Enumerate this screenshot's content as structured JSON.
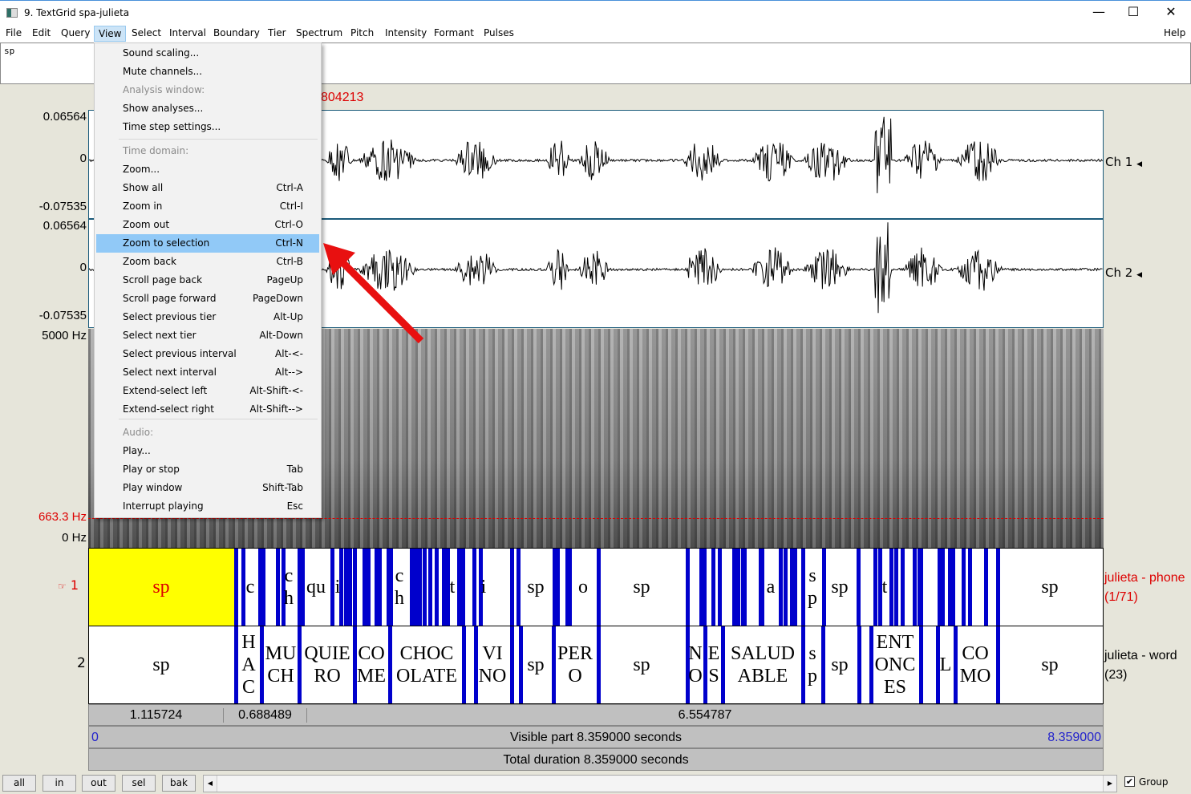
{
  "window": {
    "title": "9. TextGrid spa-julieta",
    "controls": [
      "—",
      "☐",
      "✕"
    ]
  },
  "menubar": {
    "items": [
      "File",
      "Edit",
      "Query",
      "View",
      "Select",
      "Interval",
      "Boundary",
      "Tier",
      "Spectrum",
      "Pitch",
      "Intensity",
      "Formant",
      "Pulses"
    ],
    "help": "Help"
  },
  "text_field": {
    "value": "sp"
  },
  "cursor_time": "804213",
  "axes": {
    "ch1_max": "0.06564",
    "ch1_zero": "0",
    "ch1_min": "-0.07535",
    "ch2_max": "0.06564",
    "ch2_zero": "0",
    "ch2_min": "-0.07535",
    "spec_max": "5000 Hz",
    "pitch": "663.3 Hz",
    "spec_min": "0 Hz"
  },
  "channels": {
    "ch1": "Ch 1",
    "ch2": "Ch 2"
  },
  "tiers": {
    "t1_num": "1",
    "t2_num": "2",
    "t1_name": "julieta - phone",
    "t1_count": "(1/71)",
    "t2_name": "julieta - word",
    "t2_count": "(23)",
    "phone_labels": [
      "sp",
      "c",
      "c\nh",
      "qu",
      "i",
      "c\nh",
      "t",
      "i",
      "sp",
      "o",
      "sp",
      "a",
      "s\np",
      "sp",
      "t",
      "sp"
    ],
    "word_labels": [
      "sp",
      "H\nA\nC",
      "MU\nCH",
      "QUIE\nRO",
      "CO\nME",
      "CHOC\nOLATE",
      "VI\nNO",
      "sp",
      "PER\nO",
      "sp",
      "N\nO",
      "E\nS",
      "SALUD\nABLE",
      "s\np",
      "sp",
      "ENT\nONC\nES",
      "L",
      "CO\nMO",
      "sp"
    ]
  },
  "durations": {
    "sel_before": "1.115724",
    "sel": "0.688489",
    "after": "6.554787"
  },
  "visible": {
    "start": "0",
    "label": "Visible part 8.359000 seconds",
    "end": "8.359000"
  },
  "total": {
    "label": "Total duration 8.359000 seconds"
  },
  "bottom": {
    "buttons": [
      "all",
      "in",
      "out",
      "sel",
      "bak"
    ],
    "group_label": "Group",
    "group_checked": true
  },
  "view_menu": [
    {
      "label": "Sound scaling...",
      "shortcut": ""
    },
    {
      "label": "Mute channels...",
      "shortcut": ""
    },
    {
      "label": "Analysis window:",
      "shortcut": "",
      "disabled": true
    },
    {
      "label": "Show analyses...",
      "shortcut": ""
    },
    {
      "label": "Time step settings...",
      "shortcut": ""
    },
    {
      "label": "Time domain:",
      "shortcut": "",
      "disabled": true
    },
    {
      "label": "Zoom...",
      "shortcut": ""
    },
    {
      "label": "Show all",
      "shortcut": "Ctrl-A"
    },
    {
      "label": "Zoom in",
      "shortcut": "Ctrl-I"
    },
    {
      "label": "Zoom out",
      "shortcut": "Ctrl-O"
    },
    {
      "label": "Zoom to selection",
      "shortcut": "Ctrl-N",
      "highlighted": true
    },
    {
      "label": "Zoom back",
      "shortcut": "Ctrl-B"
    },
    {
      "label": "Scroll page back",
      "shortcut": "PageUp"
    },
    {
      "label": "Scroll page forward",
      "shortcut": "PageDown"
    },
    {
      "label": "Select previous tier",
      "shortcut": "Alt-Up"
    },
    {
      "label": "Select next tier",
      "shortcut": "Alt-Down"
    },
    {
      "label": "Select previous interval",
      "shortcut": "Alt-<-"
    },
    {
      "label": "Select next interval",
      "shortcut": "Alt-->"
    },
    {
      "label": "Extend-select left",
      "shortcut": "Alt-Shift-<-"
    },
    {
      "label": "Extend-select right",
      "shortcut": "Alt-Shift-->"
    },
    {
      "label": "Audio:",
      "shortcut": "",
      "disabled": true
    },
    {
      "label": "Play...",
      "shortcut": ""
    },
    {
      "label": "Play or stop",
      "shortcut": "Tab"
    },
    {
      "label": "Play window",
      "shortcut": "Shift-Tab"
    },
    {
      "label": "Interrupt playing",
      "shortcut": "Esc"
    }
  ],
  "colors": {
    "selection": "#ffff00",
    "boundary": "#0000cc",
    "highlight": "#91c9f7",
    "arrow": "#e81010",
    "red_text": "#dd0000",
    "blue_text": "#2222cc"
  },
  "annotation": {
    "arrow_icon": "red-arrow-icon"
  }
}
